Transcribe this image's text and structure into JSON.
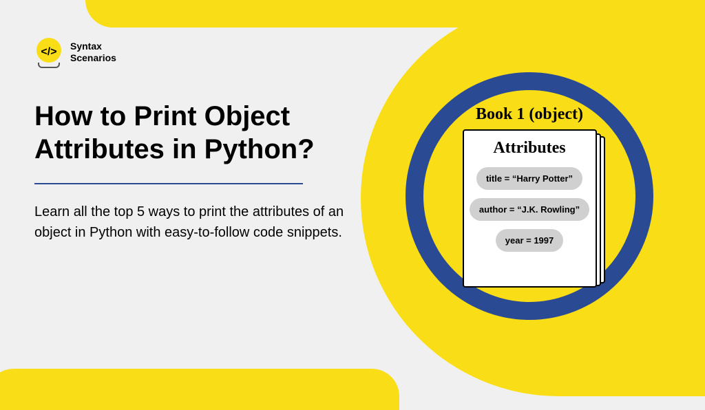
{
  "brand": {
    "name_line1": "Syntax",
    "name_line2": "Scenarios",
    "code_glyph": "</>"
  },
  "title": "How to Print Object Attributes in Python?",
  "description": "Learn all the top 5 ways to print the attributes of an object in Python with easy-to-follow code snippets.",
  "illustration": {
    "object_label": "Book 1 (object)",
    "header": "Attributes",
    "attributes": [
      "title = “Harry Potter”",
      "author = “J.K. Rowling”",
      "year = 1997"
    ]
  },
  "colors": {
    "accent_yellow": "#f9dd16",
    "accent_blue": "#2b4a94",
    "text": "#000000",
    "bg": "#f0f0f0"
  }
}
